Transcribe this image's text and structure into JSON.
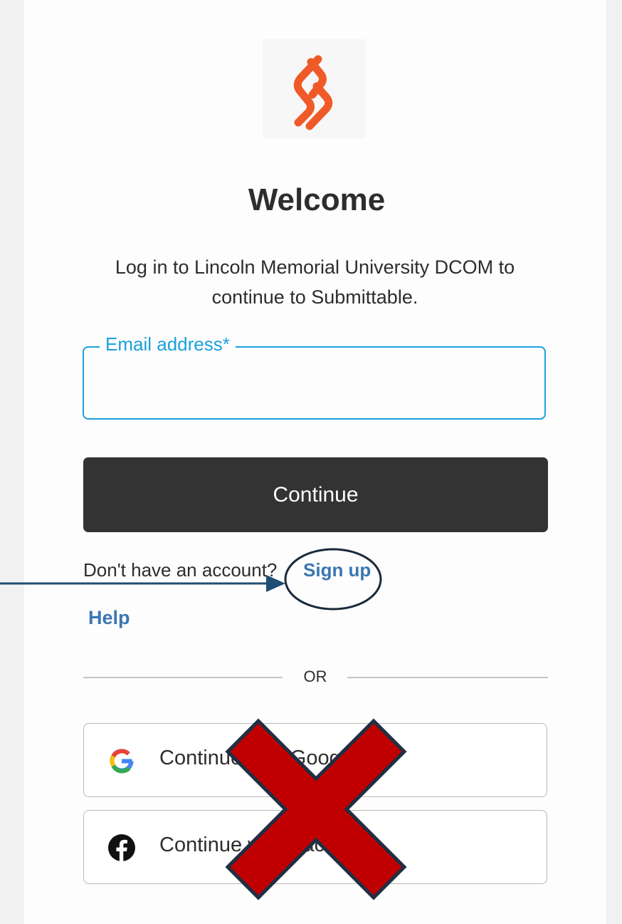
{
  "header": {
    "logo_icon": "submittable-s-logo-icon",
    "title": "Welcome",
    "subtitle": "Log in to Lincoln Memorial University DCOM to continue to Submittable."
  },
  "form": {
    "email_label": "Email address*",
    "email_value": "",
    "continue_label": "Continue"
  },
  "links": {
    "no_account_text": "Don't have an account?",
    "signup_label": "Sign up",
    "help_label": "Help"
  },
  "divider": {
    "or_label": "OR"
  },
  "social": {
    "google_label": "Continue with Google",
    "google_icon": "google-g-icon",
    "facebook_label": "Continue with Facebook",
    "facebook_icon": "facebook-icon"
  },
  "annotations": {
    "arrow_color": "#1e4e73",
    "circle_color": "#1a2a3a",
    "cross_color": "#c00000",
    "cross_outline": "#1f2f44"
  },
  "colors": {
    "accent": "#1aa0dc",
    "link": "#3b76b2",
    "button": "#333333",
    "logo": "#f05a28"
  }
}
